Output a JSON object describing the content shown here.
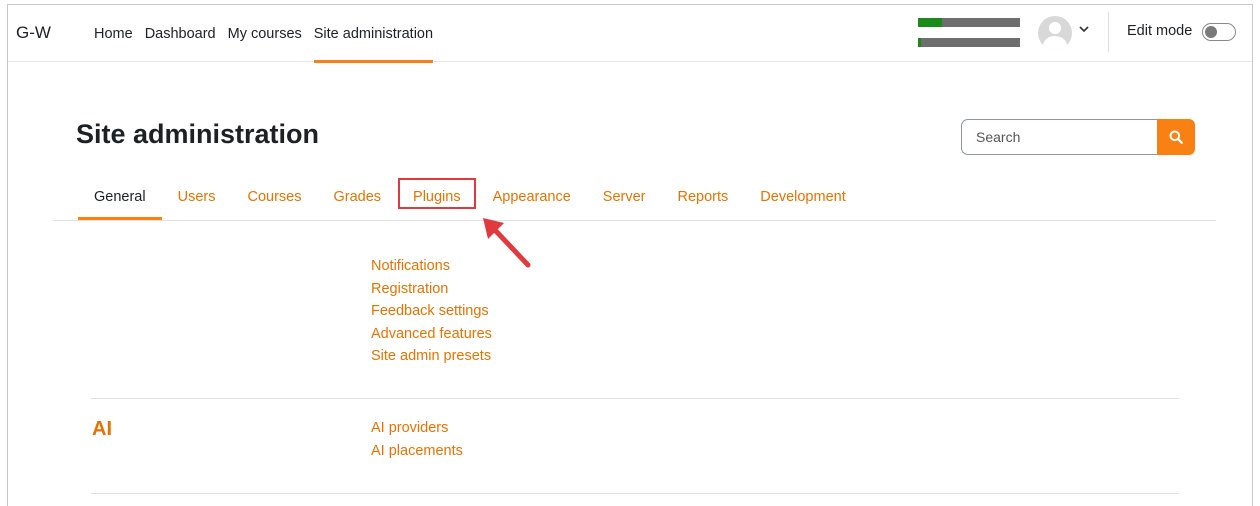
{
  "navbar": {
    "brand": "G-W",
    "links": [
      {
        "label": "Home"
      },
      {
        "label": "Dashboard"
      },
      {
        "label": "My courses"
      },
      {
        "label": "Site administration"
      }
    ],
    "active_link": "Site administration",
    "edit_mode_label": "Edit mode",
    "edit_mode_on": false
  },
  "page": {
    "title": "Site administration",
    "search_placeholder": "Search"
  },
  "tabs": [
    {
      "label": "General"
    },
    {
      "label": "Users"
    },
    {
      "label": "Courses"
    },
    {
      "label": "Grades"
    },
    {
      "label": "Plugins"
    },
    {
      "label": "Appearance"
    },
    {
      "label": "Server"
    },
    {
      "label": "Reports"
    },
    {
      "label": "Development"
    }
  ],
  "active_tab": "General",
  "highlighted_tab": "Plugins",
  "sections": {
    "general": {
      "links": [
        "Notifications",
        "Registration",
        "Feedback settings",
        "Advanced features",
        "Site admin presets"
      ]
    },
    "ai": {
      "title": "AI",
      "links": [
        "AI providers",
        "AI placements"
      ]
    }
  },
  "colors": {
    "accent": "#f98012",
    "link": "#e67300",
    "annotation": "#e0393e"
  },
  "icons": {
    "search_button": "search-icon",
    "avatar": "user-avatar-icon",
    "menu": "chevron-down-icon"
  }
}
